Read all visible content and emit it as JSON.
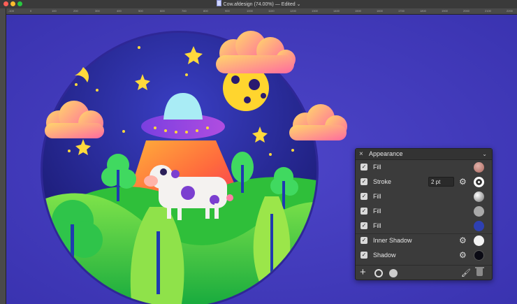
{
  "window": {
    "title": "Cow.afdesign (74.00%) — Edited",
    "title_suffix": "⌄"
  },
  "ruler": {
    "top_ticks": [
      "-100",
      "0",
      "100",
      "200",
      "300",
      "400",
      "500",
      "600",
      "700",
      "800",
      "900",
      "1000",
      "1100",
      "1200",
      "1300",
      "1400",
      "1500",
      "1600",
      "1700",
      "1800",
      "1900",
      "2000",
      "2100",
      "2200"
    ]
  },
  "panel": {
    "title": "Appearance",
    "close_icon": "×",
    "collapse_icon": "⌄",
    "rows": [
      {
        "label": "Fill",
        "color": "#c98d85",
        "type": "fill"
      },
      {
        "label": "Stroke",
        "value": "2 pt",
        "color": "#ffffff",
        "type": "stroke"
      },
      {
        "label": "Fill",
        "color": "#d0d0d0",
        "type": "fill-gradient"
      },
      {
        "label": "Fill",
        "color": "#a9a9a9",
        "type": "fill"
      },
      {
        "label": "Fill",
        "color": "#2e40b2",
        "type": "fill"
      },
      {
        "label": "Inner Shadow",
        "color": "#f2f2f2",
        "type": "effect"
      },
      {
        "label": "Shadow",
        "color": "#0a0a14",
        "type": "effect"
      }
    ],
    "check_mark": "✓",
    "gear_icon": "⚙",
    "footer": {
      "add_icon": "+",
      "brush_icon": "🖌"
    }
  }
}
